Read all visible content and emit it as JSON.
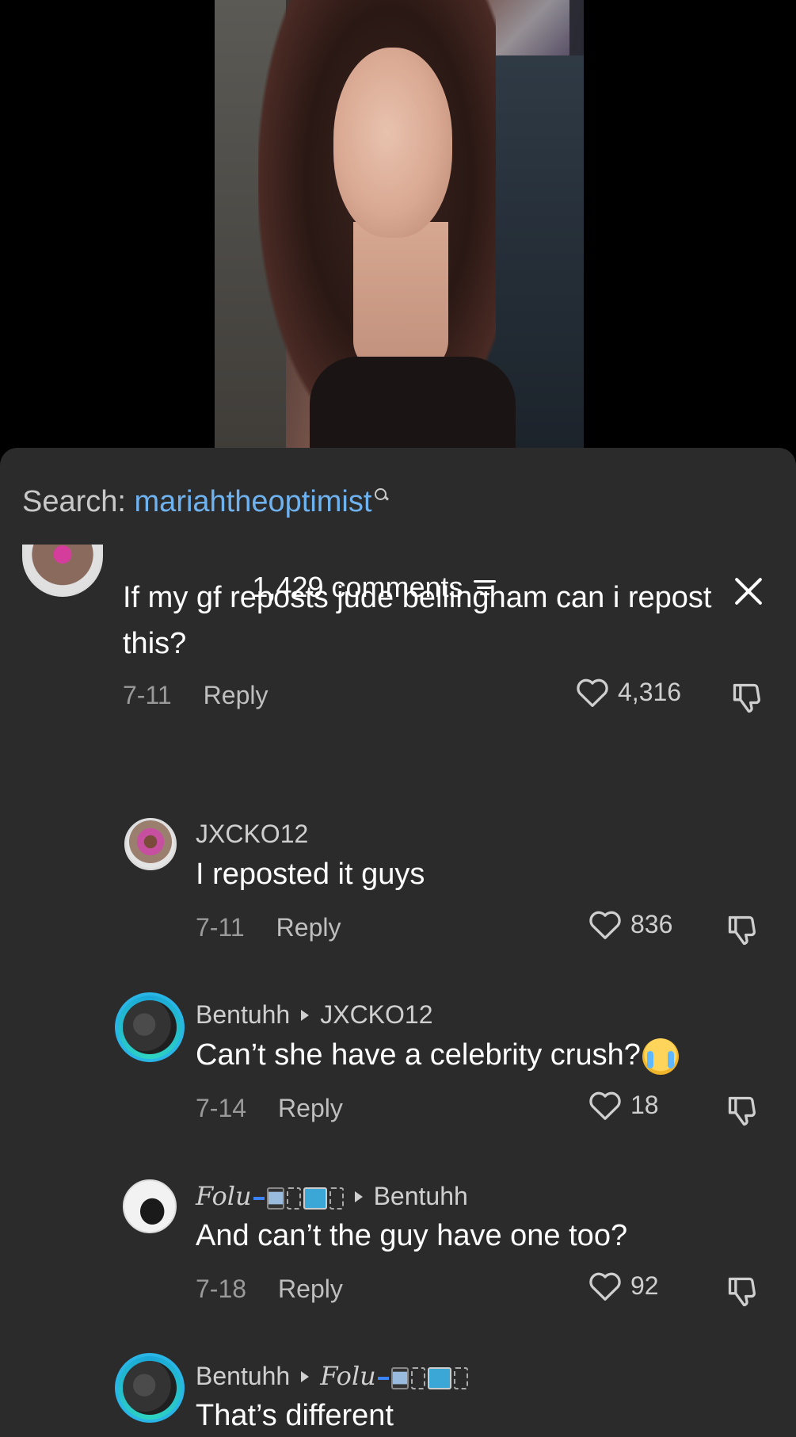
{
  "search": {
    "label": "Search:",
    "term": "mariahtheoptimist"
  },
  "header": {
    "count_label": "1,429 comments"
  },
  "comments": [
    {
      "text": "If my gf reposts jude bellingham can i repost this?",
      "date": "7-11",
      "reply_label": "Reply",
      "likes": "4,316"
    },
    {
      "username": "JXCKO12",
      "text": "I reposted it guys",
      "date": "7-11",
      "reply_label": "Reply",
      "likes": "836"
    },
    {
      "username": "Bentuhh",
      "reply_to": "JXCKO12",
      "text": "Can’t she have a celebrity crush?",
      "date": "7-14",
      "reply_label": "Reply",
      "likes": "18"
    },
    {
      "username": "Folu",
      "reply_to": "Bentuhh",
      "text": "And can’t the guy have one too?",
      "date": "7-18",
      "reply_label": "Reply",
      "likes": "92"
    },
    {
      "username": "Bentuhh",
      "reply_to": "Folu",
      "text": "That’s different"
    }
  ],
  "colors": {
    "sheet_bg": "#2b2b2b",
    "link_blue": "#6fb2f0",
    "ring_blue": "#1aa7d9"
  },
  "icons": [
    "search-icon",
    "filter-icon",
    "close-icon",
    "heart-icon",
    "dislike-icon",
    "crying-face-emoji"
  ]
}
